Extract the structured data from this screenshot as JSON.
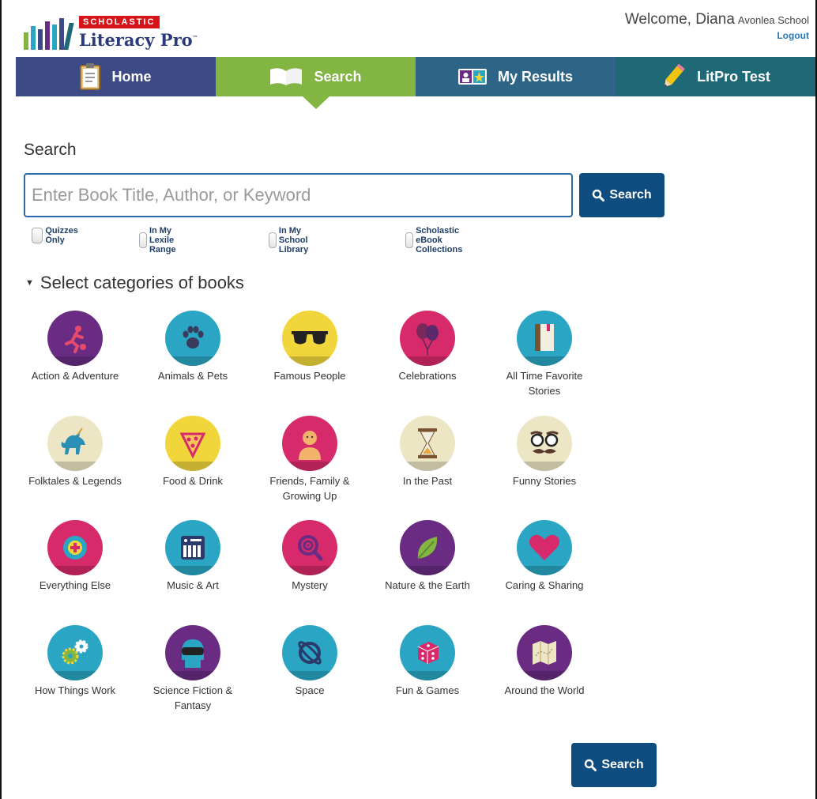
{
  "header": {
    "brand": "SCHOLASTIC",
    "product": "Literacy Pro",
    "trademark": "™",
    "welcome": "Welcome, Diana",
    "school": "Avonlea School",
    "logout": "Logout"
  },
  "nav": {
    "home": "Home",
    "search": "Search",
    "results": "My Results",
    "test": "LitPro Test",
    "colors": {
      "home": "#3c4a86",
      "search": "#82b541",
      "results": "#2e6486",
      "test": "#1f6977"
    }
  },
  "search": {
    "heading": "Search",
    "placeholder": "Enter Book Title, Author, or Keyword",
    "value": "",
    "button": "Search",
    "bottom_button": "Search",
    "filters": {
      "quizzes": "Quizzes Only",
      "lexile": "In My Lexile Range",
      "library": "In My School Library",
      "ebook": "Scholastic eBook Collections"
    }
  },
  "categories_heading": "Select categories of books",
  "categories": [
    {
      "label": "Action & Adventure",
      "color": "#6a2c82",
      "icon": "running-figure-icon"
    },
    {
      "label": "Animals & Pets",
      "color": "#2aa6c4",
      "icon": "paw-print-icon"
    },
    {
      "label": "Famous People",
      "color": "#f1d63b",
      "icon": "sunglasses-icon"
    },
    {
      "label": "Celebrations",
      "color": "#d72a6a",
      "icon": "balloons-icon"
    },
    {
      "label": "All Time Favorite Stories",
      "color": "#2aa6c4",
      "icon": "book-icon"
    },
    {
      "label": "Folktales & Legends",
      "color": "#ede6c5",
      "icon": "unicorn-icon"
    },
    {
      "label": "Food & Drink",
      "color": "#f1d63b",
      "icon": "pizza-slice-icon"
    },
    {
      "label": "Friends, Family & Growing Up",
      "color": "#d72a6a",
      "icon": "person-icon"
    },
    {
      "label": "In the Past",
      "color": "#ede6c5",
      "icon": "hourglass-icon"
    },
    {
      "label": "Funny Stories",
      "color": "#ede6c5",
      "icon": "glasses-mustache-icon"
    },
    {
      "label": "Everything Else",
      "color": "#d72a6a",
      "icon": "plus-target-icon"
    },
    {
      "label": "Music & Art",
      "color": "#2aa6c4",
      "icon": "piano-icon"
    },
    {
      "label": "Mystery",
      "color": "#d72a6a",
      "icon": "magnifying-glass-icon"
    },
    {
      "label": "Nature & the Earth",
      "color": "#6a2c82",
      "icon": "leaf-icon"
    },
    {
      "label": "Caring & Sharing",
      "color": "#2aa6c4",
      "icon": "heart-icon"
    },
    {
      "label": "How Things Work",
      "color": "#2aa6c4",
      "icon": "gears-icon"
    },
    {
      "label": "Science Fiction & Fantasy",
      "color": "#6a2c82",
      "icon": "robot-icon"
    },
    {
      "label": "Space",
      "color": "#2aa6c4",
      "icon": "planet-icon"
    },
    {
      "label": "Fun & Games",
      "color": "#2aa6c4",
      "icon": "dice-icon"
    },
    {
      "label": "Around the World",
      "color": "#6a2c82",
      "icon": "map-icon"
    }
  ]
}
